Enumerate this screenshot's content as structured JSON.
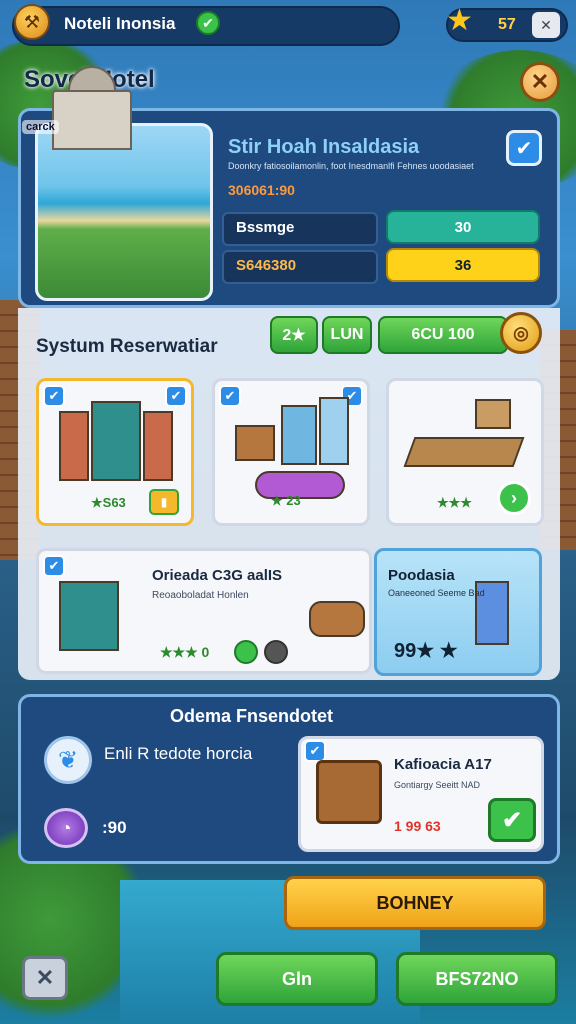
{
  "header": {
    "app_title": "Noteli Inonsia",
    "logo_icon": "gavel-icon",
    "star_count": "57"
  },
  "panel": {
    "title": "Sovel Hotel",
    "close_icon": "close-icon"
  },
  "hero": {
    "tag": "carck",
    "name": "Stir Hoah Insaldasia",
    "subtitle": "Doonkry fatiosoilamonlin, foot Inesdmanlfi Fehnes uoodasiaet",
    "price": "306061:90",
    "stats": [
      {
        "label": "Bssmge",
        "value": "30",
        "color": "#27b39a"
      },
      {
        "label": "S646380",
        "value": "36",
        "color": "#ffd21a"
      }
    ]
  },
  "system": {
    "title": "Systum Reserwatiar",
    "pill_a": "2★",
    "pill_b": "LUN",
    "pill_c": "6CU 100"
  },
  "cards": [
    {
      "rating": "★S63",
      "badge": "▮"
    },
    {
      "rating": "★ 23"
    },
    {
      "rating": "★★★"
    }
  ],
  "feature": {
    "title": "Orieada C3G aalIS",
    "subtitle": "Reoaoboladat Honlen",
    "rating": "★★★ 0"
  },
  "side_card": {
    "title": "Poodasia",
    "subtitle": "Oaneeoned Seeme Bad",
    "rating": "99★ ★"
  },
  "bottom": {
    "title": "Odema Fnsendotet",
    "desc": "Enli R tedote horcia",
    "timer": ":90"
  },
  "offer": {
    "title": "Kafioacia A17",
    "subtitle": "Gontiargy Seeitt NAD",
    "price": "1 99 63"
  },
  "actions": {
    "primary": "BOHNEY",
    "left": "Gln",
    "right": "BFS72NO"
  }
}
